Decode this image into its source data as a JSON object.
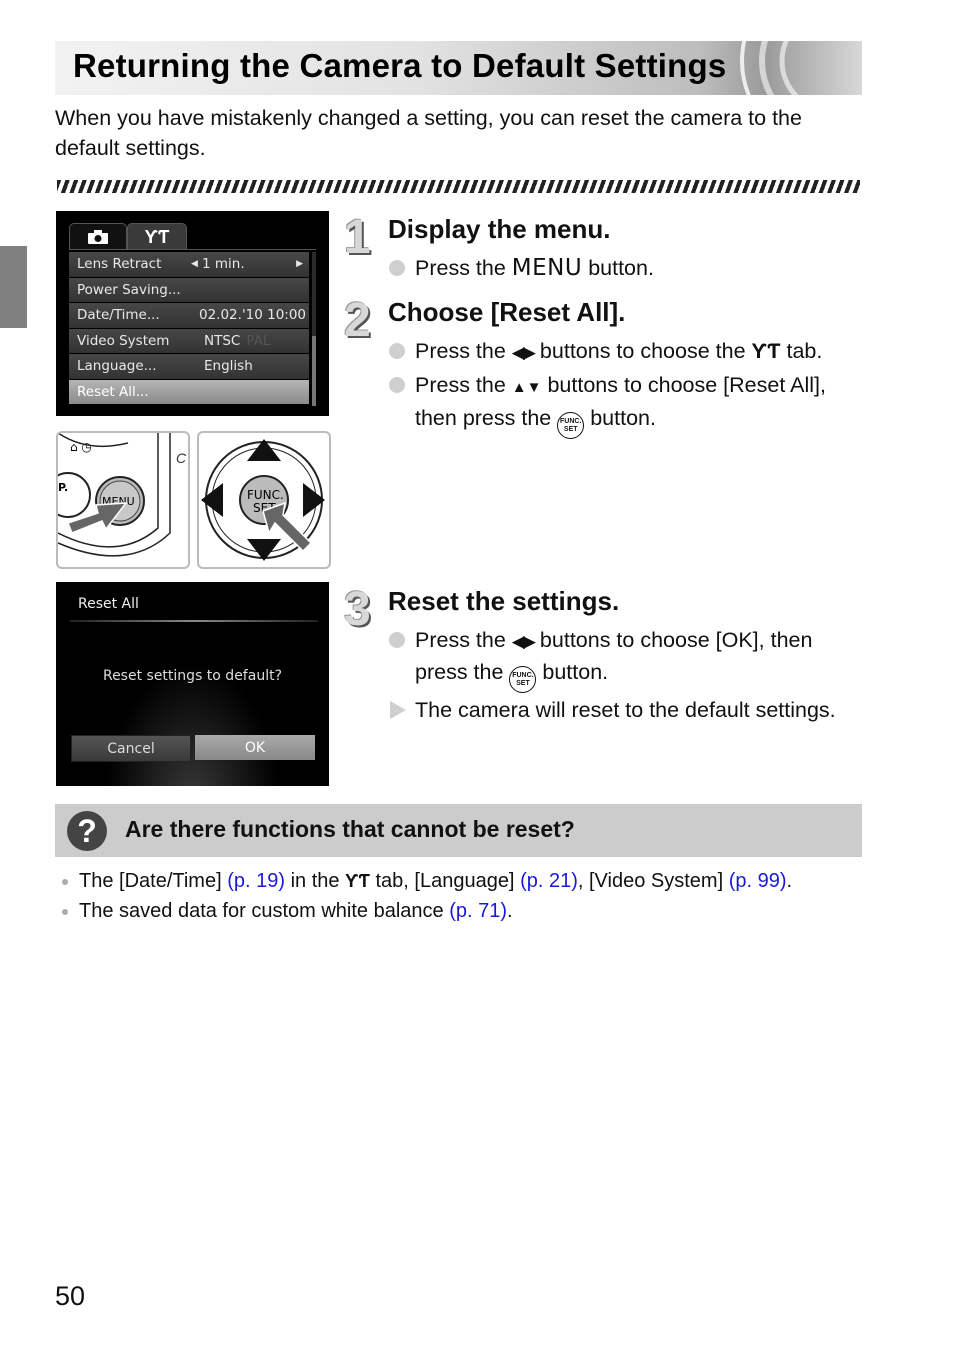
{
  "page": {
    "title": "Returning the Camera to Default Settings",
    "intro": "When you have mistakenly changed a setting, you can reset the camera to the default settings.",
    "page_number": "50"
  },
  "menu_screen": {
    "tabs": [
      {
        "icon": "camera-icon",
        "label": ""
      },
      {
        "icon": "tools-icon",
        "label": "ƳƬ"
      }
    ],
    "rows": [
      {
        "label": "Lens Retract",
        "value": "1 min.",
        "has_arrows": true
      },
      {
        "label": "Power Saving...",
        "value": ""
      },
      {
        "label": "Date/Time...",
        "value": "02.02.'10 10:00"
      },
      {
        "label": "Video System",
        "value": "NTSC",
        "value_dim": "PAL"
      },
      {
        "label": "Language...",
        "value": "English"
      },
      {
        "label": "Reset All...",
        "value": "",
        "selected": true
      }
    ]
  },
  "illustrations": {
    "menu_button_label": "MENU",
    "func_set_label_1": "FUNC.",
    "func_set_label_2": "SET"
  },
  "dialog_screen": {
    "title": "Reset All",
    "message": "Reset settings to default?",
    "cancel": "Cancel",
    "ok": "OK"
  },
  "steps": [
    {
      "number": "1",
      "title": "Display the menu.",
      "b1_pre": "Press the ",
      "b1_key": "MENU",
      "b1_post": " button."
    },
    {
      "number": "2",
      "title": "Choose [Reset All].",
      "b1_pre": "Press the ",
      "b1_key": "◀▶",
      "b1_mid": " buttons to choose the ",
      "b1_icon": "ƳƬ",
      "b1_post": " tab.",
      "b2_pre": "Press the ",
      "b2_key": "▲▼",
      "b2_mid": " buttons to choose [Reset All], then press the ",
      "b2_post": " button."
    },
    {
      "number": "3",
      "title": "Reset the settings.",
      "b1_pre": "Press the ",
      "b1_key": "◀▶",
      "b1_mid": " buttons to choose [OK], then press the ",
      "b1_post": " button.",
      "b2": "The camera will reset to the default settings."
    }
  ],
  "funcset_icon_text": {
    "top": "FUNC.",
    "bottom": "SET"
  },
  "faq": {
    "title": "Are there functions that cannot be reset?",
    "item1": {
      "t1": "The [Date/Time] ",
      "l1": "(p. 19)",
      "t2": " in the ",
      "icon": "ƳƬ",
      "t3": " tab, [Language] ",
      "l2": "(p. 21)",
      "t4": ", [Video System] ",
      "l3": "(p. 99)",
      "t5": "."
    },
    "item2": {
      "t1": "The saved data for custom white balance ",
      "l1": "(p. 71)",
      "t2": "."
    }
  },
  "colors": {
    "link": "#1a1ad6",
    "faq_bg": "#cccccc",
    "side_tab": "#808080"
  }
}
